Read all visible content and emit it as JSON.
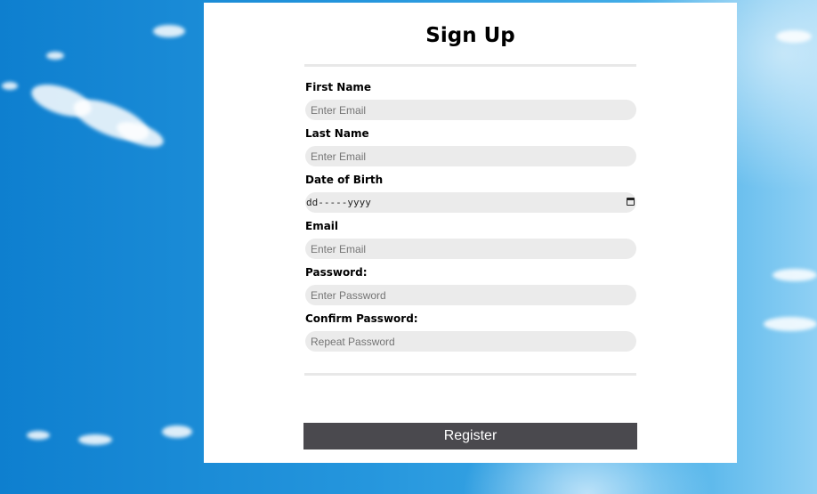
{
  "form": {
    "title": "Sign Up",
    "fields": [
      {
        "label": "First Name",
        "placeholder": "Enter Email"
      },
      {
        "label": "Last Name",
        "placeholder": "Enter Email"
      },
      {
        "label": "Date of Birth",
        "value": "dd-----yyyy"
      },
      {
        "label": "Email",
        "placeholder": "Enter Email"
      },
      {
        "label": "Password:",
        "placeholder": "Enter Password"
      },
      {
        "label": "Confirm Password:",
        "placeholder": "Repeat Password"
      }
    ],
    "submit_label": "Register"
  },
  "colors": {
    "button_background": "#4a494e",
    "input_background": "#ebebeb",
    "card_background": "#ffffff"
  },
  "icons": {
    "date_picker": "calendar-icon"
  }
}
